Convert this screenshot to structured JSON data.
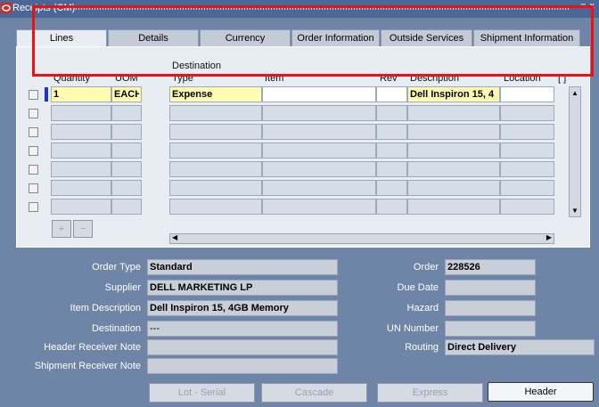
{
  "window": {
    "title": "Receipts (CM)"
  },
  "tabs": [
    {
      "label": "Lines",
      "active": true
    },
    {
      "label": "Details"
    },
    {
      "label": "Currency"
    },
    {
      "label": "Order Information"
    },
    {
      "label": "Outside Services"
    },
    {
      "label": "Shipment Information"
    }
  ],
  "columns": {
    "quantity": "Quantity",
    "uom": "UOM",
    "destination_top": "Destination",
    "destination_type": "Type",
    "item": "Item",
    "rev": "Rev",
    "description": "Description",
    "location": "Location",
    "folder": "[ ]"
  },
  "row1": {
    "quantity": "1",
    "uom": "EACH",
    "destination_type": "Expense",
    "item": "",
    "rev": "",
    "description": "Dell Inspiron 15, 4",
    "location": ""
  },
  "lower": {
    "order_type_label": "Order Type",
    "order_type": "Standard",
    "supplier_label": "Supplier",
    "supplier": "DELL MARKETING LP",
    "item_desc_label": "Item Description",
    "item_desc": "Dell Inspiron 15, 4GB Memory",
    "destination_label": "Destination",
    "destination": "---",
    "header_note_label": "Header Receiver Note",
    "shipment_note_label": "Shipment Receiver Note",
    "order_label": "Order",
    "order": "228526",
    "due_date_label": "Due Date",
    "hazard_label": "Hazard",
    "un_number_label": "UN Number",
    "routing_label": "Routing",
    "routing": "Direct Delivery"
  },
  "buttons": {
    "lot_serial": "Lot - Serial",
    "cascade": "Cascade",
    "express": "Express",
    "header": "Header"
  },
  "colors": {
    "highlight_box": "#ee1111",
    "required_field": "#fffbb0",
    "background": "#6e85a7"
  }
}
